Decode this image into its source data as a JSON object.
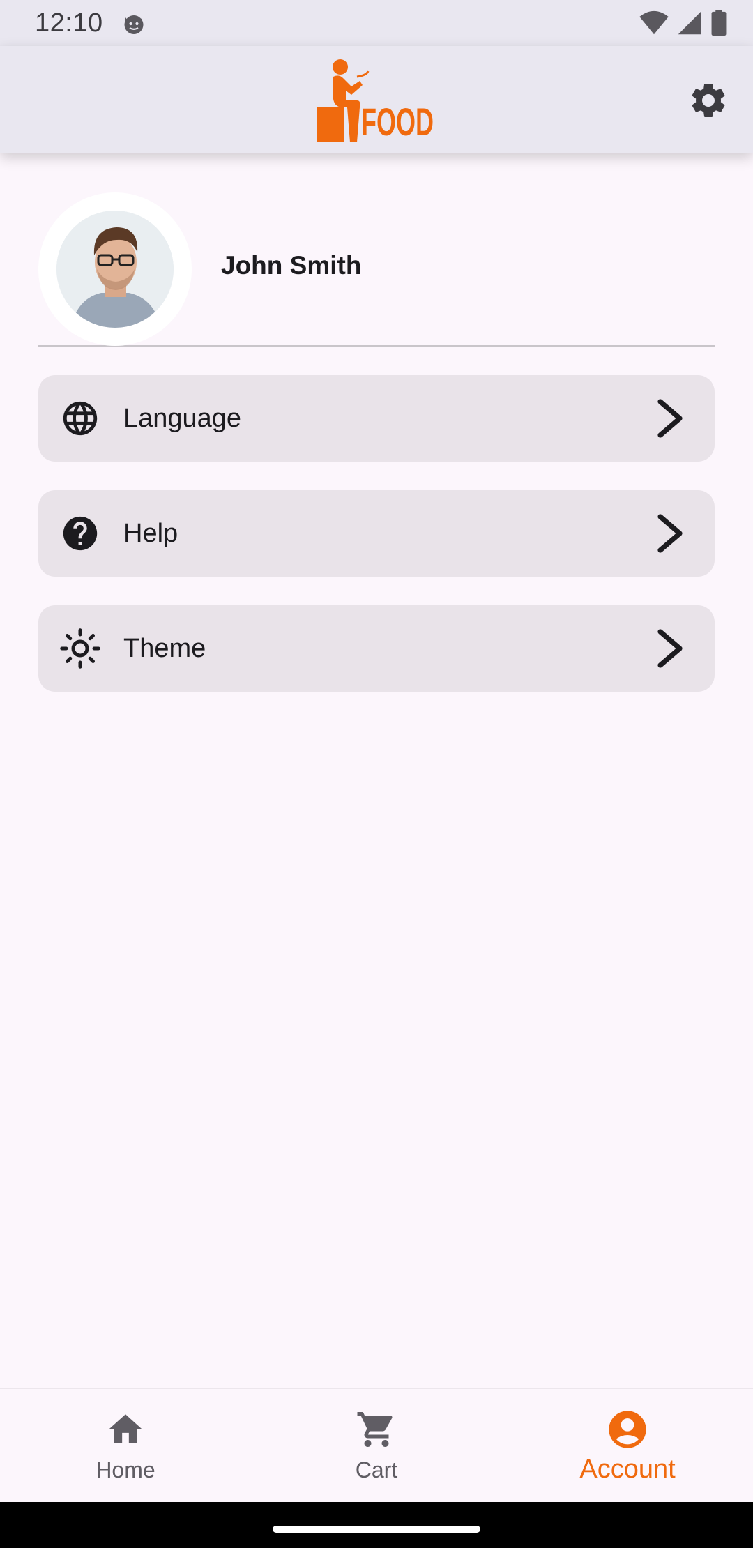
{
  "status_bar": {
    "time": "12:10"
  },
  "app_bar": {
    "logo_text": "FOOD",
    "colors": {
      "brand": "#f06a0e",
      "bar_bg": "#e9e7f0"
    }
  },
  "profile": {
    "name": "John Smith"
  },
  "menu": [
    {
      "label": "Language",
      "icon": "globe-icon"
    },
    {
      "label": "Help",
      "icon": "help-circle-icon"
    },
    {
      "label": "Theme",
      "icon": "sun-icon"
    }
  ],
  "bottom_nav": {
    "items": [
      {
        "label": "Home",
        "icon": "home-icon",
        "active": false
      },
      {
        "label": "Cart",
        "icon": "cart-icon",
        "active": false
      },
      {
        "label": "Account",
        "icon": "account-circle-icon",
        "active": true
      }
    ],
    "active_color": "#f06a0e"
  }
}
